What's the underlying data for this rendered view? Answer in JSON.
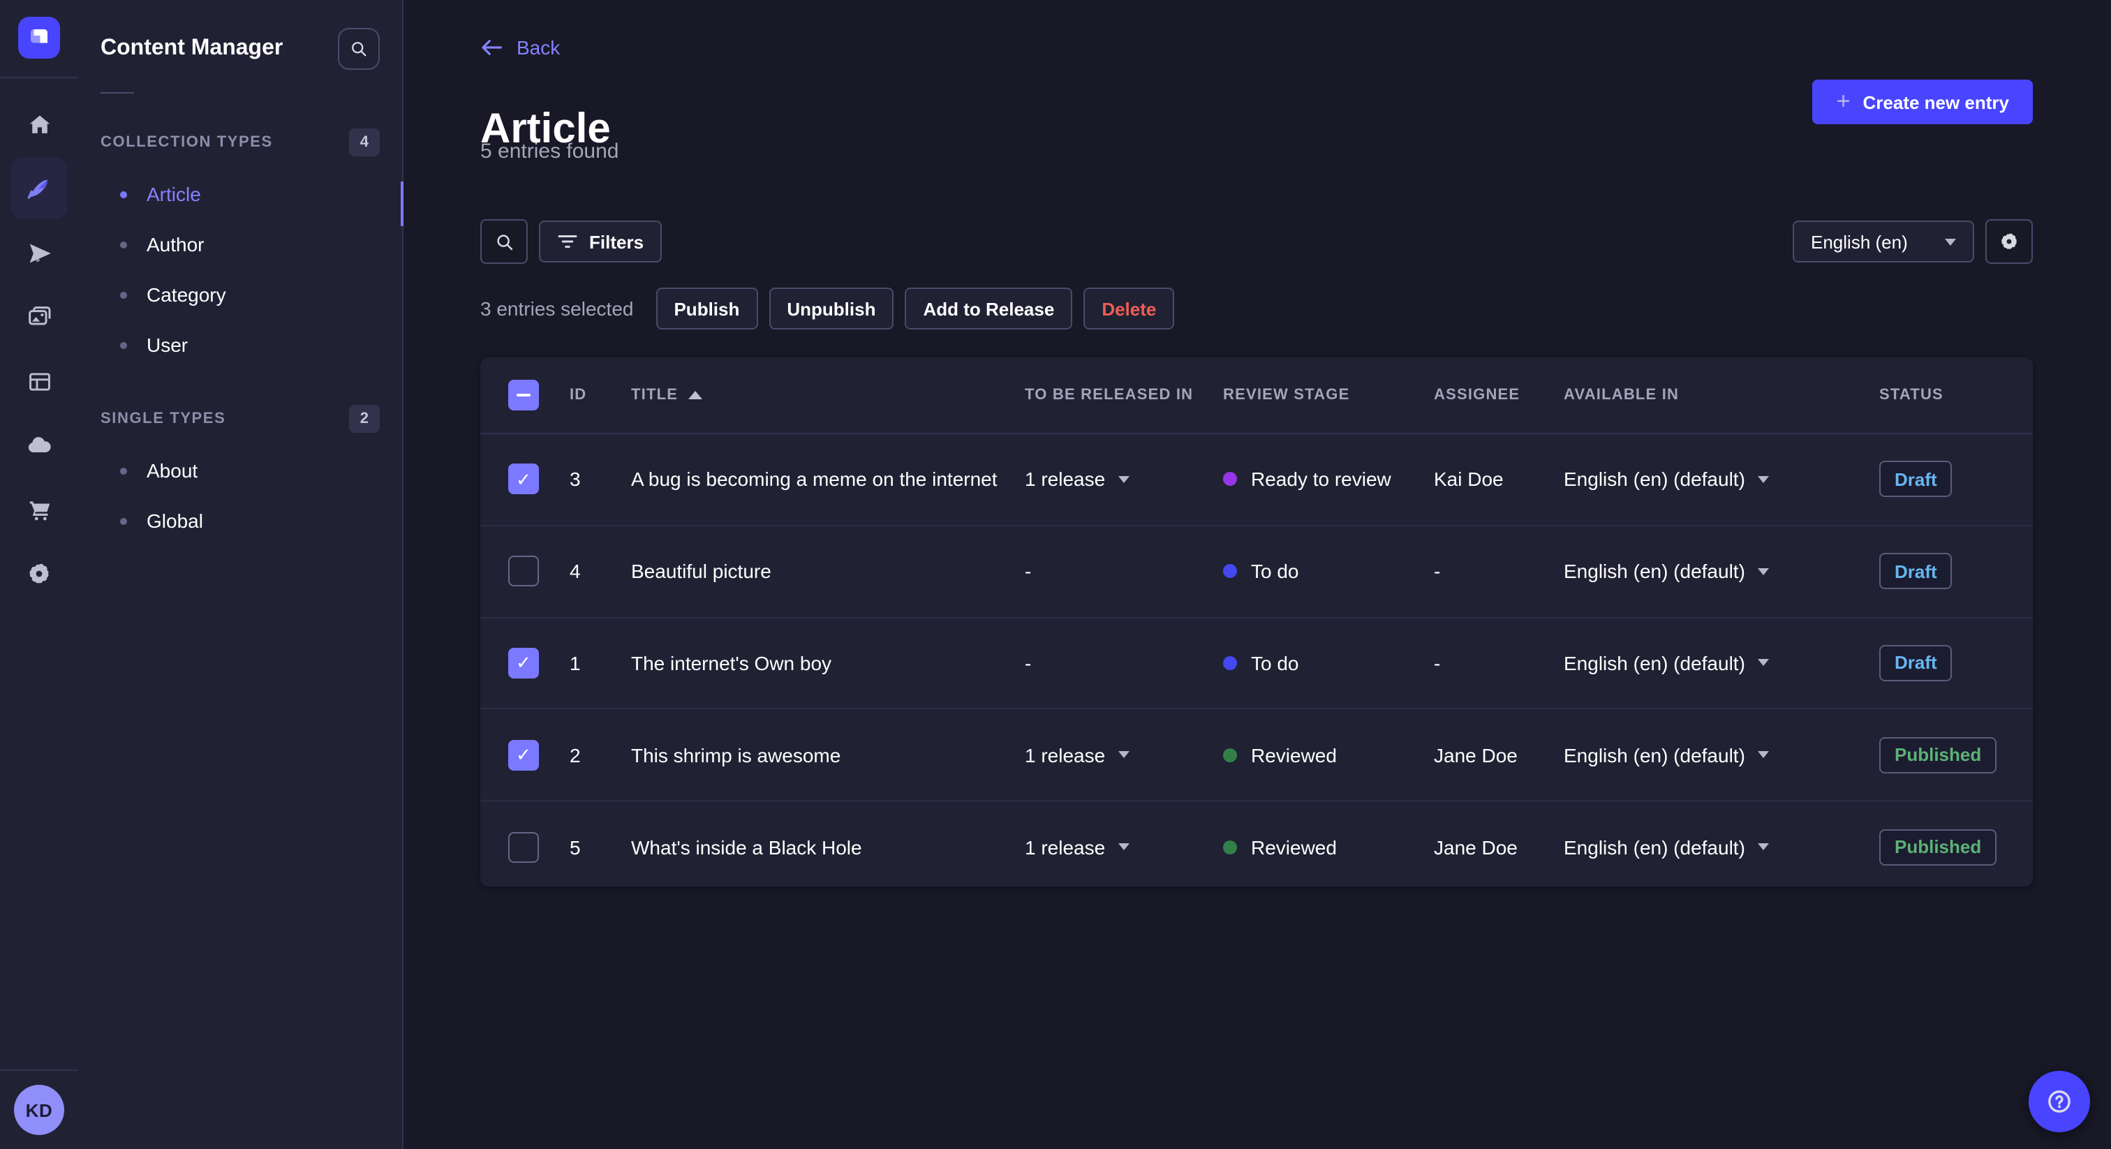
{
  "rail": {
    "logo": "strapi-logo",
    "items": [
      {
        "icon": "home",
        "active": false
      },
      {
        "icon": "feather-content-manager",
        "active": true
      },
      {
        "icon": "paper-plane",
        "active": false
      },
      {
        "icon": "media-library",
        "active": false
      },
      {
        "icon": "layout-builder",
        "active": false
      },
      {
        "icon": "cloud",
        "active": false
      },
      {
        "icon": "cart",
        "active": false
      },
      {
        "icon": "gear",
        "active": false
      }
    ],
    "avatar_initials": "KD"
  },
  "sidebar": {
    "title": "Content Manager",
    "sections": [
      {
        "label": "COLLECTION TYPES",
        "count": "4",
        "items": [
          {
            "label": "Article",
            "active": true
          },
          {
            "label": "Author",
            "active": false
          },
          {
            "label": "Category",
            "active": false
          },
          {
            "label": "User",
            "active": false
          }
        ]
      },
      {
        "label": "SINGLE TYPES",
        "count": "2",
        "items": [
          {
            "label": "About",
            "active": false
          },
          {
            "label": "Global",
            "active": false
          }
        ]
      }
    ]
  },
  "header": {
    "back": "Back",
    "title": "Article",
    "subtitle": "5 entries found",
    "create": "Create new entry"
  },
  "toolbar": {
    "filters": "Filters",
    "locale": "English (en)"
  },
  "selection": {
    "summary": "3 entries selected",
    "publish": "Publish",
    "unpublish": "Unpublish",
    "add_to_release": "Add to Release",
    "delete": "Delete"
  },
  "table": {
    "headers": {
      "id": "ID",
      "title": "TITLE",
      "release": "TO BE RELEASED IN",
      "review": "REVIEW STAGE",
      "assignee": "ASSIGNEE",
      "available": "AVAILABLE IN",
      "status": "STATUS"
    },
    "rows": [
      {
        "checked": true,
        "id": "3",
        "title": "A bug is becoming a meme on the internet",
        "release": "1 release",
        "has_release": true,
        "review": "Ready to review",
        "review_color": "#9736e8",
        "assignee": "Kai Doe",
        "available": "English (en) (default)",
        "status": "Draft",
        "status_color": "#66b7f1"
      },
      {
        "checked": false,
        "id": "4",
        "title": "Beautiful picture",
        "release": "-",
        "has_release": false,
        "review": "To do",
        "review_color": "#4348f0",
        "assignee": "-",
        "available": "English (en) (default)",
        "status": "Draft",
        "status_color": "#66b7f1"
      },
      {
        "checked": true,
        "id": "1",
        "title": "The internet's Own boy",
        "release": "-",
        "has_release": false,
        "review": "To do",
        "review_color": "#4348f0",
        "assignee": "-",
        "available": "English (en) (default)",
        "status": "Draft",
        "status_color": "#66b7f1"
      },
      {
        "checked": true,
        "id": "2",
        "title": "This shrimp is awesome",
        "release": "1 release",
        "has_release": true,
        "review": "Reviewed",
        "review_color": "#328048",
        "assignee": "Jane Doe",
        "available": "English (en) (default)",
        "status": "Published",
        "status_color": "#5cb176"
      },
      {
        "checked": false,
        "id": "5",
        "title": "What's inside a Black Hole",
        "release": "1 release",
        "has_release": true,
        "review": "Reviewed",
        "review_color": "#328048",
        "assignee": "Jane Doe",
        "available": "English (en) (default)",
        "status": "Published",
        "status_color": "#5cb176"
      }
    ]
  }
}
